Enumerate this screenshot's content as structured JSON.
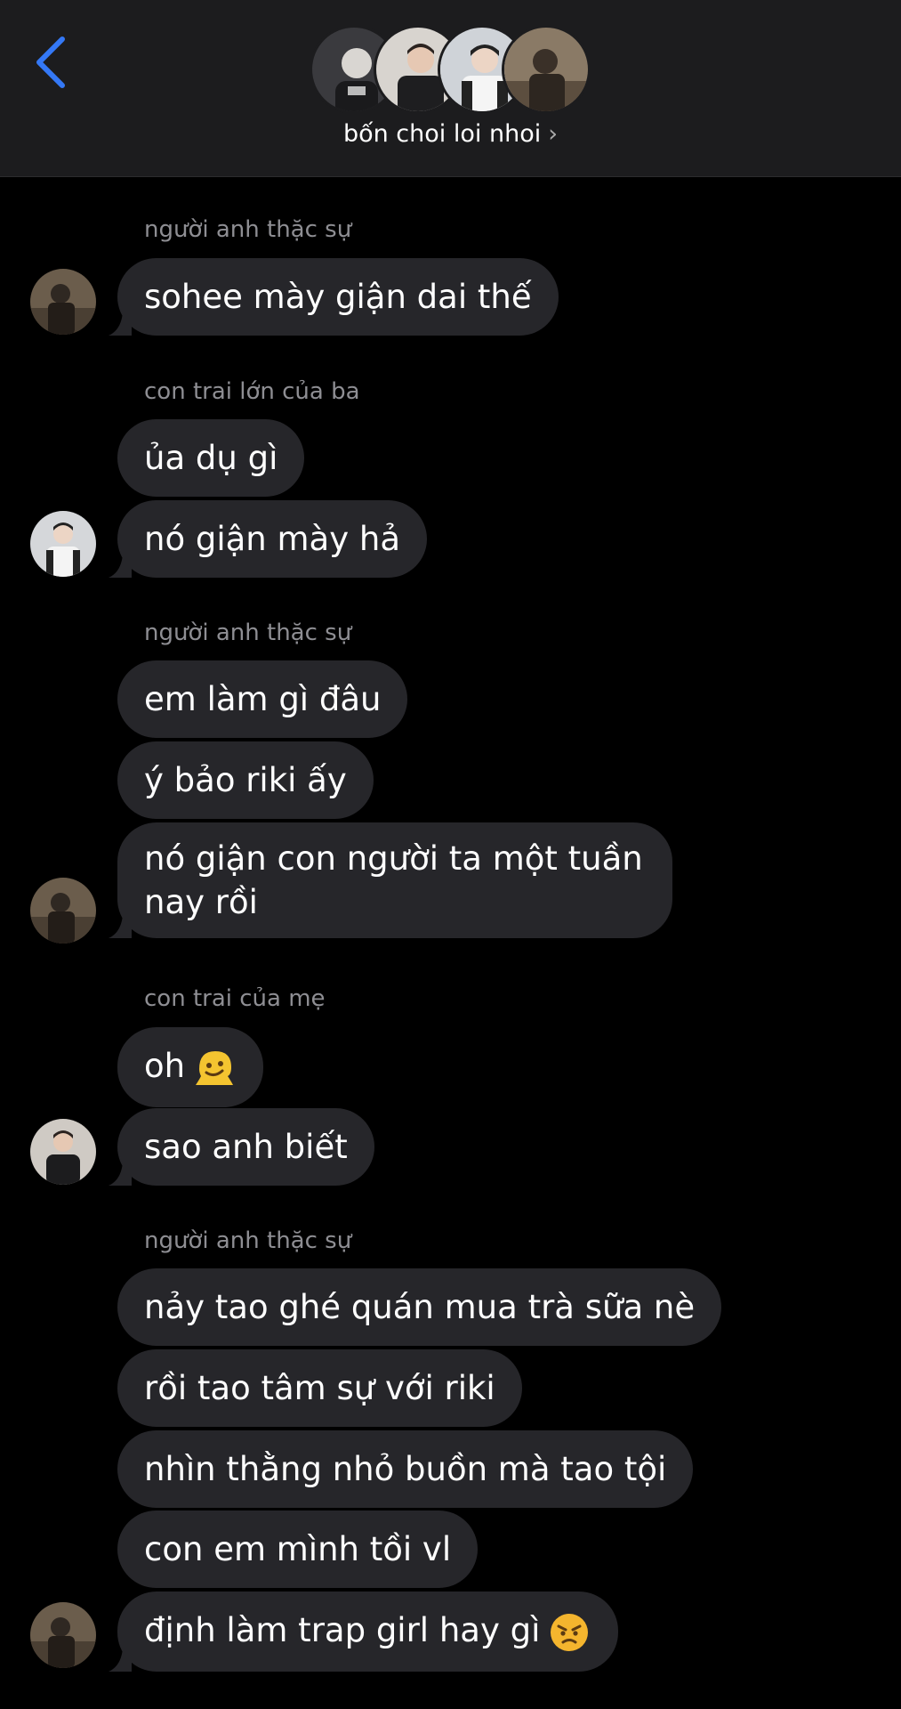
{
  "header": {
    "title": "bốn choi loi nhoi",
    "chevron": "›"
  },
  "messages": [
    {
      "sender": "người anh thặc sự",
      "text": "sohee mày giận dai thế"
    },
    {
      "sender": "con trai lớn của ba",
      "text": "ủa dụ gì"
    },
    {
      "text": "nó giận mày hả"
    },
    {
      "sender": "người anh thặc sự",
      "text": "em làm gì đâu"
    },
    {
      "text": "ý bảo riki ấy"
    },
    {
      "text": "nó giận con người ta một tuần nay rồi"
    },
    {
      "sender": "con trai của mẹ",
      "text": "oh",
      "emoji": "melting-face-emoji"
    },
    {
      "text": "sao anh biết"
    },
    {
      "sender": "người anh thặc sự",
      "text": "nảy tao ghé quán mua trà sữa nè"
    },
    {
      "text": "rồi tao tâm sự với riki"
    },
    {
      "text": "nhìn thằng nhỏ buồn mà tao tội"
    },
    {
      "text": "con em mình tồi vl"
    },
    {
      "text": "định làm trap girl hay gì",
      "emoji": "angry-face-emoji"
    }
  ],
  "colors": {
    "background": "#000000",
    "header_bg": "#1c1c1e",
    "bubble_bg": "#26262a",
    "sender_text": "#8e8e93",
    "accent_blue": "#3478f6"
  },
  "icons": {
    "back": "chevron-left-icon"
  }
}
